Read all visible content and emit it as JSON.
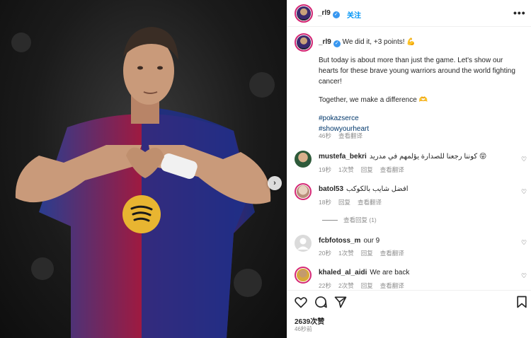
{
  "post": {
    "username": "_rl9",
    "follow_label": "关注",
    "verified_mark": "✓",
    "more_label": "•••",
    "caption_line1": "We did it, +3 points! 💪",
    "caption_para1": "But today is about more than just the game. Let's show our hearts for these brave young warriors around the world fighting cancer!",
    "caption_para2": "Together, we make a difference 🫶",
    "hashtags": [
      "#pokazserce",
      "#showyourheart"
    ],
    "caption_time": "46秒",
    "translate_label": "查看翻译"
  },
  "comments": [
    {
      "username": "mustefa_bekri",
      "text": "كوننا رجعنا للصدارة يؤلمهم في مدريد 😝",
      "time": "19秒",
      "likes": "1次赞",
      "reply": "回复",
      "translate": "查看翻译"
    },
    {
      "username": "batol53",
      "text": "افضل شايب بالكوكب",
      "time": "18秒",
      "reply": "回复",
      "translate": "查看翻译",
      "view_replies": "查看回复 (1)"
    },
    {
      "username": "fcbfotoss_m",
      "text": "our 9",
      "time": "20秒",
      "likes": "1次赞",
      "reply": "回复",
      "translate": "查看翻译"
    },
    {
      "username": "khaled_al_aidi",
      "text": "We are back",
      "time": "22秒",
      "likes": "2次赞",
      "reply": "回复",
      "translate": "查看翻译"
    }
  ],
  "footer": {
    "likes": "2639次赞",
    "posted_ago": "46秒前"
  },
  "colors": {
    "accent": "#0095f6",
    "verified": "#3897f0",
    "muted": "#8e8e8e",
    "hashtag": "#00376b"
  },
  "icons": [
    "heart-icon",
    "comment-icon",
    "share-icon",
    "bookmark-icon",
    "next-arrow-icon",
    "more-icon",
    "verified-icon"
  ]
}
